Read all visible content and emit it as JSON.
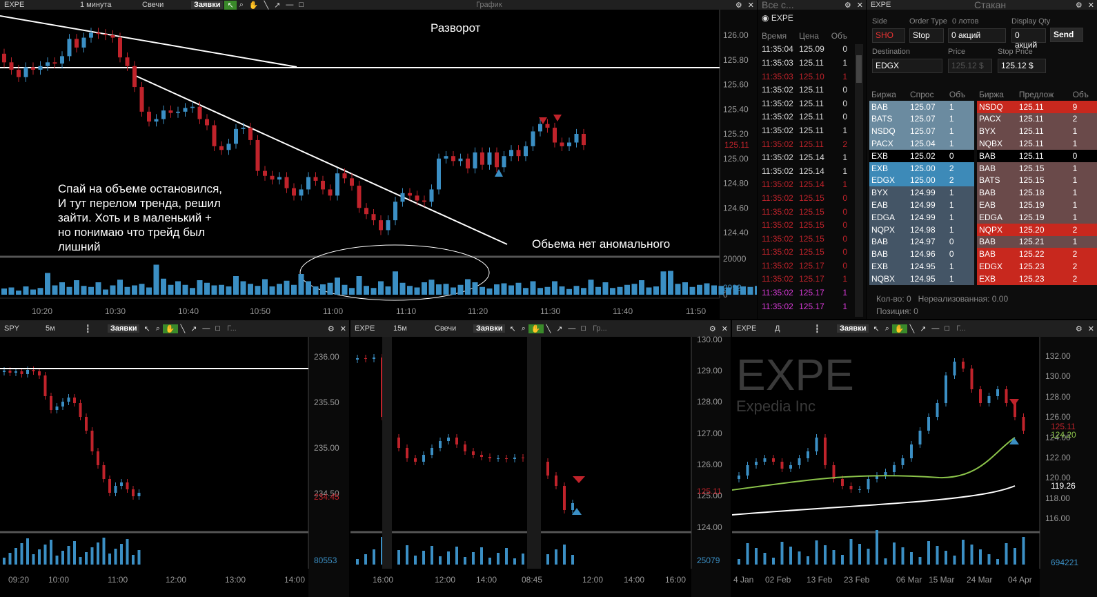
{
  "main_chart": {
    "toolbar": {
      "symbol": "EXPE",
      "interval": "1 минута",
      "chart_type": "Свечи",
      "orders": "Заявки",
      "title": "График"
    },
    "y_ticks": [
      "126.00",
      "125.80",
      "125.60",
      "125.40",
      "125.20",
      "125.00",
      "124.80",
      "124.60",
      "124.40"
    ],
    "last_price": "125.11",
    "volume_ticks": [
      "20000",
      "2992",
      "0"
    ],
    "x_ticks": [
      "10:20",
      "10:30",
      "10:40",
      "10:50",
      "11:00",
      "11:10",
      "11:20",
      "11:30",
      "11:40",
      "11:50"
    ],
    "annotations": {
      "reversal": "Разворот",
      "comment": "Спай на объеме остановился,\nИ тут перелом тренда, решил\nзайти. Хоть и в маленький +\nно понимаю что трейд был\nлишний",
      "no_volume": "Обьема нет  аномального"
    },
    "chart_data": {
      "type": "candlestick",
      "title": "",
      "xlabel": "",
      "ylabel": "",
      "ylim": [
        124.3,
        126.1
      ],
      "x": [
        "10:15",
        "10:16",
        "10:17",
        "10:18",
        "10:19",
        "10:20",
        "10:21",
        "10:22",
        "10:23",
        "10:24",
        "10:25",
        "10:26",
        "10:27",
        "10:28",
        "10:29",
        "10:30",
        "10:31",
        "10:32",
        "10:33",
        "10:34",
        "10:35",
        "10:36",
        "10:37",
        "10:38",
        "10:39",
        "10:40",
        "10:41",
        "10:42",
        "10:43",
        "10:44",
        "10:45",
        "10:46",
        "10:47",
        "10:48",
        "10:49",
        "10:50",
        "10:51",
        "10:52",
        "10:53",
        "10:54",
        "10:55",
        "10:56",
        "10:57",
        "10:58",
        "10:59",
        "11:00",
        "11:01",
        "11:02",
        "11:03",
        "11:04",
        "11:05",
        "11:06",
        "11:07",
        "11:08",
        "11:09",
        "11:10",
        "11:11",
        "11:12",
        "11:13",
        "11:14",
        "11:15",
        "11:16",
        "11:17",
        "11:18",
        "11:19",
        "11:20",
        "11:21",
        "11:22",
        "11:23",
        "11:24",
        "11:25",
        "11:26",
        "11:27",
        "11:28",
        "11:29",
        "11:30",
        "11:31",
        "11:32",
        "11:33",
        "11:34",
        "11:35"
      ],
      "open": [
        125.85,
        125.78,
        125.72,
        125.66,
        125.74,
        125.72,
        125.75,
        125.78,
        125.77,
        125.83,
        125.97,
        125.9,
        125.98,
        126.02,
        126.01,
        126.0,
        125.98,
        125.82,
        125.75,
        125.58,
        125.38,
        125.3,
        125.32,
        125.39,
        125.37,
        125.38,
        125.41,
        125.42,
        125.32,
        125.27,
        125.1,
        125.07,
        125.12,
        125.24,
        125.25,
        125.15,
        124.9,
        124.86,
        124.83,
        124.85,
        124.76,
        124.7,
        124.75,
        124.85,
        124.82,
        124.75,
        124.7,
        124.88,
        124.84,
        124.78,
        124.6,
        124.55,
        124.5,
        124.42,
        124.5,
        124.65,
        124.72,
        124.7,
        124.66,
        124.65,
        124.75,
        125.0,
        125.02,
        124.98,
        125.0,
        124.92,
        125.05,
        124.95,
        125.05,
        124.93,
        125.02,
        125.07,
        125.02,
        125.1,
        125.22,
        125.28,
        125.25,
        125.13,
        125.1,
        125.13,
        125.2
      ],
      "close": [
        125.78,
        125.72,
        125.66,
        125.74,
        125.72,
        125.75,
        125.78,
        125.77,
        125.83,
        125.97,
        125.9,
        125.98,
        126.02,
        126.01,
        126.0,
        125.98,
        125.82,
        125.75,
        125.58,
        125.38,
        125.3,
        125.32,
        125.39,
        125.37,
        125.38,
        125.41,
        125.42,
        125.32,
        125.27,
        125.1,
        125.07,
        125.12,
        125.24,
        125.25,
        125.15,
        124.9,
        124.86,
        124.83,
        124.85,
        124.76,
        124.7,
        124.75,
        124.85,
        124.82,
        124.75,
        124.7,
        124.88,
        124.84,
        124.78,
        124.6,
        124.55,
        124.5,
        124.42,
        124.5,
        124.65,
        124.72,
        124.7,
        124.66,
        124.65,
        124.75,
        125.0,
        125.02,
        124.98,
        125.0,
        124.92,
        125.05,
        124.95,
        125.05,
        124.93,
        125.02,
        125.07,
        125.02,
        125.1,
        125.22,
        125.28,
        125.25,
        125.13,
        125.1,
        125.13,
        125.2,
        125.11
      ],
      "volume": [
        1200,
        1400,
        800,
        1600,
        1000,
        1300,
        4200,
        1800,
        2400,
        1500,
        2800,
        1700,
        1500,
        2400,
        1000,
        1800,
        2900,
        1500,
        1800,
        2100,
        1400,
        5800,
        3100,
        1900,
        2600,
        1900,
        1300,
        2800,
        2300,
        1800,
        1900,
        1600,
        3600,
        2600,
        2100,
        1700,
        3000,
        1600,
        2100,
        2700,
        1900,
        4000,
        2600,
        1600,
        2000,
        2300,
        3300,
        1900,
        1300,
        3600,
        1700,
        1300,
        2600,
        1600,
        4500,
        2300,
        1700,
        1400,
        2400,
        2900,
        2000,
        2100,
        1400,
        1900,
        3000,
        2400,
        1500,
        1200,
        2000,
        2200,
        1800,
        2300,
        1300,
        2600,
        1300,
        1500,
        2600,
        1600,
        1100,
        1700,
        1300
      ],
      "extra_volume": [
        2900,
        1500,
        2400,
        1300,
        1500,
        1900,
        2100,
        2800,
        1400,
        1600,
        4500,
        4600,
        2100,
        2400,
        1500,
        1900,
        2200,
        1800,
        1700,
        1400,
        1800,
        1600,
        1500,
        1700
      ]
    }
  },
  "time_sales": {
    "title": "Все с...",
    "symbol": "EXPE",
    "columns": [
      "Время",
      "Цена",
      "Объ"
    ],
    "rows": [
      [
        "11:35:04",
        "125.09",
        "0",
        "w"
      ],
      [
        "11:35:03",
        "125.11",
        "1",
        "w"
      ],
      [
        "11:35:03",
        "125.10",
        "1",
        "r"
      ],
      [
        "11:35:02",
        "125.11",
        "0",
        "w"
      ],
      [
        "11:35:02",
        "125.11",
        "0",
        "w"
      ],
      [
        "11:35:02",
        "125.11",
        "0",
        "w"
      ],
      [
        "11:35:02",
        "125.11",
        "1",
        "w"
      ],
      [
        "11:35:02",
        "125.11",
        "2",
        "r"
      ],
      [
        "11:35:02",
        "125.14",
        "1",
        "w"
      ],
      [
        "11:35:02",
        "125.14",
        "1",
        "w"
      ],
      [
        "11:35:02",
        "125.14",
        "1",
        "r"
      ],
      [
        "11:35:02",
        "125.15",
        "0",
        "r"
      ],
      [
        "11:35:02",
        "125.15",
        "0",
        "r"
      ],
      [
        "11:35:02",
        "125.15",
        "0",
        "r"
      ],
      [
        "11:35:02",
        "125.15",
        "0",
        "r"
      ],
      [
        "11:35:02",
        "125.15",
        "0",
        "r"
      ],
      [
        "11:35:02",
        "125.17",
        "0",
        "r"
      ],
      [
        "11:35:02",
        "125.17",
        "1",
        "r"
      ],
      [
        "11:35:02",
        "125.17",
        "1",
        "p"
      ],
      [
        "11:35:02",
        "125.17",
        "1",
        "p"
      ]
    ]
  },
  "level2": {
    "title": "Стакан",
    "symbol": "EXPE",
    "order": {
      "side_label": "Side",
      "side": "SHO",
      "type_label": "Order Type",
      "type": "Stop",
      "qty_label": "0 лотов",
      "qty": "0 акций",
      "display_label": "Display Qty",
      "display": "0 акций",
      "send": "Send",
      "dest_label": "Destination",
      "dest": "EDGX",
      "price_label": "Price",
      "price": "125.12 $",
      "stop_label": "Stop Price",
      "stop": "125.12 $"
    },
    "bid_columns": [
      "Биржа",
      "Спрос",
      "Объ"
    ],
    "ask_columns": [
      "Биржа",
      "Предлож",
      "Объ"
    ],
    "bids": [
      [
        "BAB",
        "125.07",
        "1",
        "#6b8ba0"
      ],
      [
        "BATS",
        "125.07",
        "1",
        "#6b8ba0"
      ],
      [
        "NSDQ",
        "125.07",
        "1",
        "#6b8ba0"
      ],
      [
        "PACX",
        "125.04",
        "1",
        "#6b8ba0"
      ],
      [
        "EXB",
        "125.02",
        "0",
        "#000"
      ],
      [
        "EXB",
        "125.00",
        "2",
        "#3d8ab8"
      ],
      [
        "EDGX",
        "125.00",
        "2",
        "#3d8ab8"
      ],
      [
        "BYX",
        "124.99",
        "1",
        "#445566"
      ],
      [
        "EAB",
        "124.99",
        "1",
        "#445566"
      ],
      [
        "EDGA",
        "124.99",
        "1",
        "#445566"
      ],
      [
        "NQPX",
        "124.98",
        "1",
        "#445566"
      ],
      [
        "BAB",
        "124.97",
        "0",
        "#445566"
      ],
      [
        "BAB",
        "124.96",
        "0",
        "#445566"
      ],
      [
        "EXB",
        "124.95",
        "1",
        "#445566"
      ],
      [
        "NQBX",
        "124.95",
        "1",
        "#445566"
      ]
    ],
    "asks": [
      [
        "NSDQ",
        "125.11",
        "9",
        "#c8281e"
      ],
      [
        "PACX",
        "125.11",
        "2",
        "#6a4a4a"
      ],
      [
        "BYX",
        "125.11",
        "1",
        "#6a4a4a"
      ],
      [
        "NQBX",
        "125.11",
        "1",
        "#6a4a4a"
      ],
      [
        "BAB",
        "125.11",
        "0",
        "#000"
      ],
      [
        "BAB",
        "125.15",
        "1",
        "#6a4a4a"
      ],
      [
        "BATS",
        "125.15",
        "1",
        "#6a4a4a"
      ],
      [
        "BAB",
        "125.18",
        "1",
        "#6a4a4a"
      ],
      [
        "EAB",
        "125.19",
        "1",
        "#6a4a4a"
      ],
      [
        "EDGA",
        "125.19",
        "1",
        "#6a4a4a"
      ],
      [
        "NQPX",
        "125.20",
        "2",
        "#c8281e"
      ],
      [
        "BAB",
        "125.21",
        "1",
        "#6a4a4a"
      ],
      [
        "BAB",
        "125.22",
        "2",
        "#c8281e"
      ],
      [
        "EDGX",
        "125.23",
        "2",
        "#c8281e"
      ],
      [
        "EXB",
        "125.23",
        "2",
        "#c8281e"
      ]
    ],
    "footer": {
      "qty": "Кол-во: 0",
      "unrealized": "Нереализованная: 0.00",
      "position": "Позиция: 0"
    }
  },
  "spy_chart": {
    "toolbar": {
      "symbol": "SPY",
      "interval": "5м",
      "orders": "Заявки",
      "title": "Г..."
    },
    "y_ticks": [
      "236.00",
      "235.50",
      "235.00",
      "234.50"
    ],
    "last_price": "234.45",
    "volume": "80553",
    "x_ticks": [
      "09:20",
      "10:00",
      "11:00",
      "12:00",
      "13:00",
      "14:00"
    ]
  },
  "expe15_chart": {
    "toolbar": {
      "symbol": "EXPE",
      "interval": "15м",
      "chart_type": "Свечи",
      "orders": "Заявки",
      "title": "Гр..."
    },
    "y_ticks": [
      "130.00",
      "129.00",
      "128.00",
      "127.00",
      "126.00",
      "125.00",
      "124.00"
    ],
    "last_price": "125.11",
    "volume": "25079",
    "x_ticks": [
      "16:00",
      "12:00",
      "14:00",
      "08:45",
      "12:00",
      "14:00",
      "16:00"
    ]
  },
  "expeD_chart": {
    "toolbar": {
      "symbol": "EXPE",
      "interval": "Д",
      "orders": "Заявки",
      "title": "Г..."
    },
    "watermark": "EXPE",
    "company": "Expedia Inc",
    "y_ticks": [
      "132.00",
      "130.00",
      "128.00",
      "126.00",
      "124.00",
      "122.00",
      "120.00",
      "118.00",
      "116.00"
    ],
    "last_price": "125.11",
    "ma1": "124.20",
    "ma2": "119.26",
    "volume": "694221",
    "x_ticks": [
      "4 Jan",
      "02 Feb",
      "13 Feb",
      "23 Feb",
      "06 Mar",
      "15 Mar",
      "24 Mar",
      "04 Apr"
    ]
  }
}
